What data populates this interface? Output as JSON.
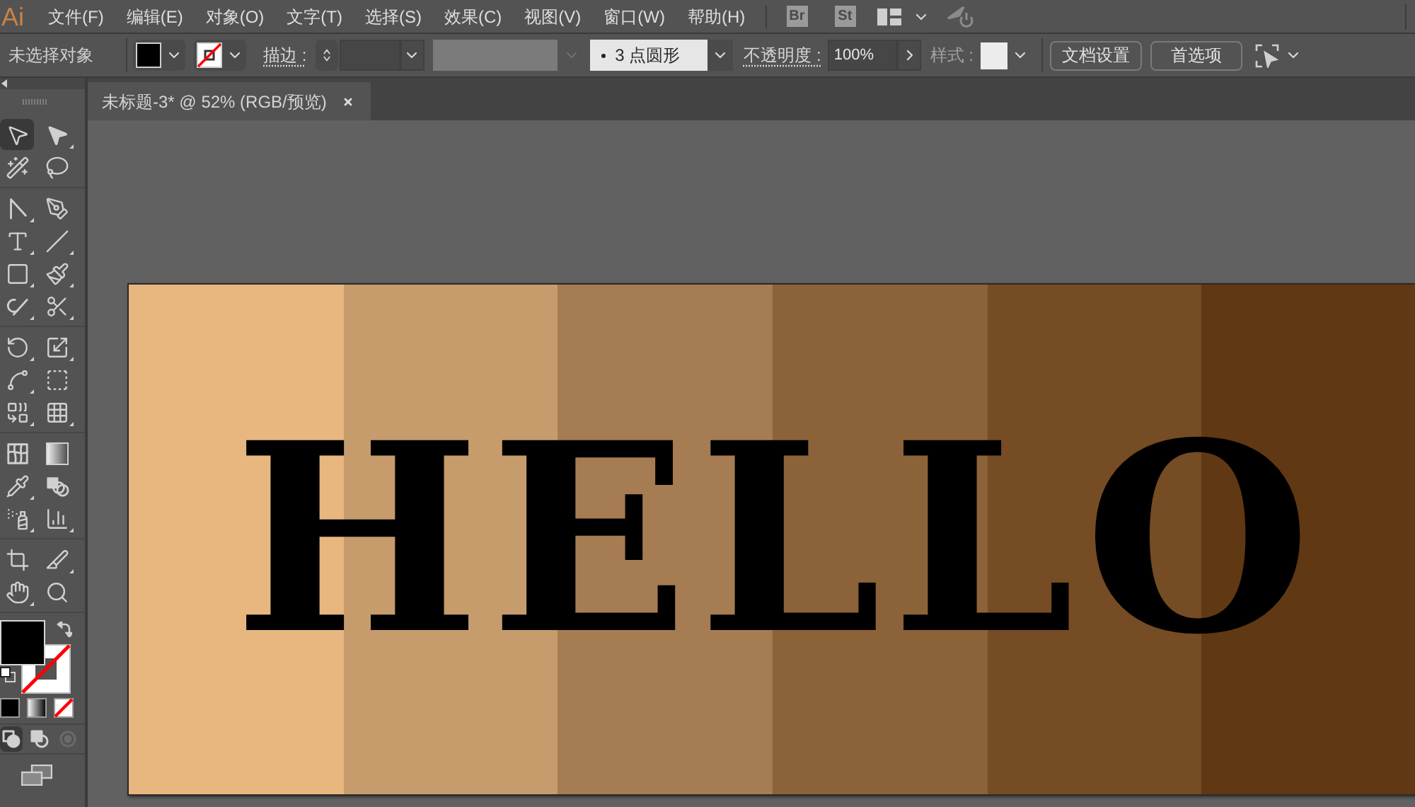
{
  "menu_bar": {
    "logo": "Ai",
    "items": [
      "文件(F)",
      "编辑(E)",
      "对象(O)",
      "文字(T)",
      "选择(S)",
      "效果(C)",
      "视图(V)",
      "窗口(W)",
      "帮助(H)"
    ],
    "app_badges": [
      "Br",
      "St"
    ]
  },
  "control_bar": {
    "selection_status": "未选择对象",
    "stroke_label": "描边 :",
    "brush": "3 点圆形",
    "opacity_label": "不透明度 :",
    "opacity": "100%",
    "style_label": "样式 :",
    "buttons": [
      "文档设置",
      "首选项"
    ]
  },
  "document_tab": {
    "title": "未标题-3* @ 52% (RGB/预览)"
  },
  "toolbox": {
    "groups": [
      {
        "tools": [
          {
            "kind": "selection",
            "selected": true,
            "flyout": false
          },
          {
            "kind": "direct_selection",
            "selected": false,
            "flyout": true
          },
          {
            "kind": "magic_wand",
            "selected": false,
            "flyout": false
          },
          {
            "kind": "lasso",
            "selected": false,
            "flyout": false
          }
        ]
      },
      {
        "tools": [
          {
            "kind": "curvature",
            "selected": false,
            "flyout": true
          },
          {
            "kind": "pen",
            "selected": false,
            "flyout": false
          },
          {
            "kind": "type",
            "selected": false,
            "flyout": true
          },
          {
            "kind": "line",
            "selected": false,
            "flyout": true
          },
          {
            "kind": "rectangle",
            "selected": false,
            "flyout": true
          },
          {
            "kind": "paintbrush",
            "selected": false,
            "flyout": true
          },
          {
            "kind": "shaper",
            "selected": false,
            "flyout": true
          },
          {
            "kind": "scissors",
            "selected": false,
            "flyout": true
          }
        ]
      },
      {
        "tools": [
          {
            "kind": "rotate",
            "selected": false,
            "flyout": true
          },
          {
            "kind": "scale",
            "selected": false,
            "flyout": true
          },
          {
            "kind": "width",
            "selected": false,
            "flyout": true
          },
          {
            "kind": "free_transform",
            "selected": false,
            "flyout": false
          },
          {
            "kind": "shape_builder",
            "selected": false,
            "flyout": true
          },
          {
            "kind": "perspective_grid",
            "selected": false,
            "flyout": true
          }
        ]
      },
      {
        "tools": [
          {
            "kind": "mesh",
            "selected": false,
            "flyout": false
          },
          {
            "kind": "gradient",
            "selected": false,
            "flyout": false
          },
          {
            "kind": "eyedropper",
            "selected": false,
            "flyout": true
          },
          {
            "kind": "blend",
            "selected": false,
            "flyout": false
          },
          {
            "kind": "symbol_sprayer",
            "selected": false,
            "flyout": true
          },
          {
            "kind": "column_graph",
            "selected": false,
            "flyout": true
          }
        ]
      },
      {
        "tools": [
          {
            "kind": "artboard",
            "selected": false,
            "flyout": false
          },
          {
            "kind": "slice",
            "selected": false,
            "flyout": true
          },
          {
            "kind": "hand",
            "selected": false,
            "flyout": true
          },
          {
            "kind": "zoom",
            "selected": false,
            "flyout": false
          }
        ]
      }
    ],
    "fill_modes": [
      {
        "kind": "color"
      },
      {
        "kind": "gradient"
      },
      {
        "kind": "none"
      }
    ],
    "draw_modes": [
      {
        "kind": "normal",
        "selected": true,
        "disabled": false
      },
      {
        "kind": "behind",
        "selected": false,
        "disabled": false
      },
      {
        "kind": "inside",
        "selected": false,
        "disabled": true
      }
    ]
  },
  "artboard": {
    "stripes": [
      {
        "color": "#e8b77f"
      },
      {
        "color": "#c69c6d"
      },
      {
        "color": "#a67c52"
      },
      {
        "color": "#8c6239"
      },
      {
        "color": "#754c24"
      },
      {
        "color": "#603813"
      }
    ],
    "text": "HELLO"
  }
}
